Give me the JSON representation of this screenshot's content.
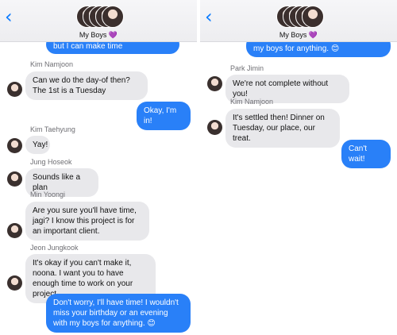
{
  "header": {
    "group_name": "My Boys 💜",
    "back_glyph": "‹"
  },
  "left": {
    "partial_top_text": "but I can make time",
    "messages": [
      {
        "sender": "Kim Namjoon",
        "text": "Can we do the day-of then? The 1st is a Tuesday"
      },
      {
        "sender": "",
        "text": "Okay, I'm in!"
      },
      {
        "sender": "Kim Taehyung",
        "text": "Yay!"
      },
      {
        "sender": "Jung Hoseok",
        "text": "Sounds like a plan"
      },
      {
        "sender": "Min Yoongi",
        "text": "Are you sure you'll have time, jagi? I know this project is for an important client."
      },
      {
        "sender": "Jeon Jungkook",
        "text": "It's okay if you can't make it, noona. I want you to have enough time to work on your project."
      },
      {
        "sender": "",
        "text": "Don't worry, I'll have time! I wouldn't miss your birthday or an evening with my boys for anything. 😊"
      }
    ]
  },
  "right": {
    "partial_top_text": "my boys for anything. 😊",
    "messages": [
      {
        "sender": "Park Jimin",
        "text": "We're not complete without you!"
      },
      {
        "sender": "Kim Namjoon",
        "text": "It's settled then! Dinner on Tuesday, our place, our treat."
      },
      {
        "sender": "",
        "text": "Can't wait!"
      }
    ]
  }
}
